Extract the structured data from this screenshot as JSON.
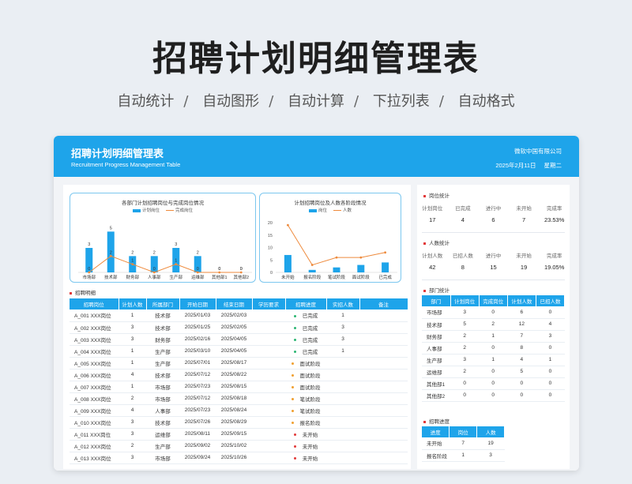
{
  "hero": {
    "title": "招聘计划明细管理表",
    "features": [
      "自动统计",
      "自动图形",
      "自动计算",
      "下拉列表",
      "自动格式"
    ]
  },
  "header": {
    "title": "招聘计划明细管理表",
    "subtitle": "Recruitment Progress Management Table",
    "company": "微软中国有限公司",
    "date": "2025年2月11日",
    "weekday": "星期二"
  },
  "colors": {
    "accent": "#1ea4ea",
    "line": "#ee8a3c",
    "done": "#2bb673",
    "phase": "#f0a030",
    "notstarted": "#e23a3a"
  },
  "chart_data": [
    {
      "type": "bar",
      "title": "各部门计划招聘岗位与完成岗位情况",
      "categories": [
        "市场部",
        "技术部",
        "财务部",
        "人事部",
        "生产部",
        "运维部",
        "其他部1",
        "其他部2"
      ],
      "series": [
        {
          "name": "计划岗位",
          "type": "bar",
          "values": [
            3,
            5,
            2,
            2,
            3,
            2,
            0,
            0
          ]
        },
        {
          "name": "完成岗位",
          "type": "line",
          "values": [
            0,
            2,
            1,
            0,
            1,
            0,
            0,
            0
          ]
        }
      ],
      "ylim": [
        0,
        6
      ]
    },
    {
      "type": "bar",
      "title": "计划招聘岗位及人数各阶段情况",
      "categories": [
        "未开始",
        "报名阶段",
        "笔试阶段",
        "面试阶段",
        "已完成"
      ],
      "series": [
        {
          "name": "岗位",
          "type": "bar",
          "values": [
            7,
            1,
            2,
            3,
            4
          ]
        },
        {
          "name": "人数",
          "type": "line",
          "values": [
            19,
            3,
            6,
            6,
            8
          ]
        }
      ],
      "yticks": [
        0,
        5,
        10,
        15,
        20
      ],
      "ylim": [
        0,
        20
      ]
    }
  ],
  "detail": {
    "title": "招聘明细",
    "columns": [
      "招聘岗位",
      "计划人数",
      "所属部门",
      "开始日期",
      "结束日期",
      "学历要求",
      "招聘进度",
      "实招人数",
      "备注"
    ],
    "rows": [
      {
        "pos": "A_001 XXX岗位",
        "plan": "1",
        "dept": "技术部",
        "start": "2025/01/03",
        "end": "2025/02/03",
        "edu": "",
        "status": "已完成",
        "kind": "done",
        "hired": "1",
        "note": ""
      },
      {
        "pos": "A_002 XXX岗位",
        "plan": "3",
        "dept": "技术部",
        "start": "2025/01/25",
        "end": "2025/02/05",
        "edu": "",
        "status": "已完成",
        "kind": "done",
        "hired": "3",
        "note": ""
      },
      {
        "pos": "A_003 XXX岗位",
        "plan": "3",
        "dept": "财务部",
        "start": "2025/02/16",
        "end": "2025/04/05",
        "edu": "",
        "status": "已完成",
        "kind": "done",
        "hired": "3",
        "note": ""
      },
      {
        "pos": "A_004 XXX岗位",
        "plan": "1",
        "dept": "生产部",
        "start": "2025/03/10",
        "end": "2025/04/05",
        "edu": "",
        "status": "已完成",
        "kind": "done",
        "hired": "1",
        "note": ""
      },
      {
        "pos": "A_005 XXX岗位",
        "plan": "1",
        "dept": "生产部",
        "start": "2025/07/01",
        "end": "2025/08/17",
        "edu": "",
        "status": "面试阶段",
        "kind": "phase",
        "hired": "",
        "note": ""
      },
      {
        "pos": "A_006 XXX岗位",
        "plan": "4",
        "dept": "技术部",
        "start": "2025/07/12",
        "end": "2025/08/22",
        "edu": "",
        "status": "面试阶段",
        "kind": "phase",
        "hired": "",
        "note": ""
      },
      {
        "pos": "A_007 XXX岗位",
        "plan": "1",
        "dept": "市场部",
        "start": "2025/07/23",
        "end": "2025/08/15",
        "edu": "",
        "status": "面试阶段",
        "kind": "phase",
        "hired": "",
        "note": ""
      },
      {
        "pos": "A_008 XXX岗位",
        "plan": "2",
        "dept": "市场部",
        "start": "2025/07/12",
        "end": "2025/08/18",
        "edu": "",
        "status": "笔试阶段",
        "kind": "phase",
        "hired": "",
        "note": ""
      },
      {
        "pos": "A_009 XXX岗位",
        "plan": "4",
        "dept": "人事部",
        "start": "2025/07/23",
        "end": "2025/08/24",
        "edu": "",
        "status": "笔试阶段",
        "kind": "phase",
        "hired": "",
        "note": ""
      },
      {
        "pos": "A_010 XXX岗位",
        "plan": "3",
        "dept": "技术部",
        "start": "2025/07/26",
        "end": "2025/08/29",
        "edu": "",
        "status": "报名阶段",
        "kind": "phase",
        "hired": "",
        "note": ""
      },
      {
        "pos": "A_011 XXX岗位",
        "plan": "3",
        "dept": "运维部",
        "start": "2025/08/11",
        "end": "2025/09/15",
        "edu": "",
        "status": "未开始",
        "kind": "notstarted",
        "hired": "",
        "note": ""
      },
      {
        "pos": "A_012 XXX岗位",
        "plan": "2",
        "dept": "生产部",
        "start": "2025/09/02",
        "end": "2025/10/02",
        "edu": "",
        "status": "未开始",
        "kind": "notstarted",
        "hired": "",
        "note": ""
      },
      {
        "pos": "A_013 XXX岗位",
        "plan": "3",
        "dept": "市场部",
        "start": "2025/09/24",
        "end": "2025/10/26",
        "edu": "",
        "status": "未开始",
        "kind": "notstarted",
        "hired": "",
        "note": ""
      }
    ]
  },
  "position_stats": {
    "title": "岗位统计",
    "labels": [
      "计划岗位",
      "已完成",
      "进行中",
      "未开始",
      "完成率"
    ],
    "values": [
      "17",
      "4",
      "6",
      "7",
      "23.53%"
    ]
  },
  "people_stats": {
    "title": "人数统计",
    "labels": [
      "计划人数",
      "已招人数",
      "进行中",
      "未开始",
      "完成率"
    ],
    "values": [
      "42",
      "8",
      "15",
      "19",
      "19.05%"
    ]
  },
  "dept_stats": {
    "title": "部门统计",
    "columns": [
      "部门",
      "计划岗位",
      "完成岗位",
      "计划人数",
      "已招人数"
    ],
    "rows": [
      [
        "市场部",
        "3",
        "0",
        "6",
        "0"
      ],
      [
        "技术部",
        "5",
        "2",
        "12",
        "4"
      ],
      [
        "财务部",
        "2",
        "1",
        "7",
        "3"
      ],
      [
        "人事部",
        "2",
        "0",
        "8",
        "0"
      ],
      [
        "生产部",
        "3",
        "1",
        "4",
        "1"
      ],
      [
        "运维部",
        "2",
        "0",
        "5",
        "0"
      ],
      [
        "其他部1",
        "0",
        "0",
        "0",
        "0"
      ],
      [
        "其他部2",
        "0",
        "0",
        "0",
        "0"
      ]
    ]
  },
  "progress_stats": {
    "title": "招聘进度",
    "columns": [
      "进度",
      "岗位",
      "人数"
    ],
    "rows": [
      [
        "未开始",
        "7",
        "19"
      ],
      [
        "报名阶段",
        "1",
        "3"
      ]
    ]
  }
}
